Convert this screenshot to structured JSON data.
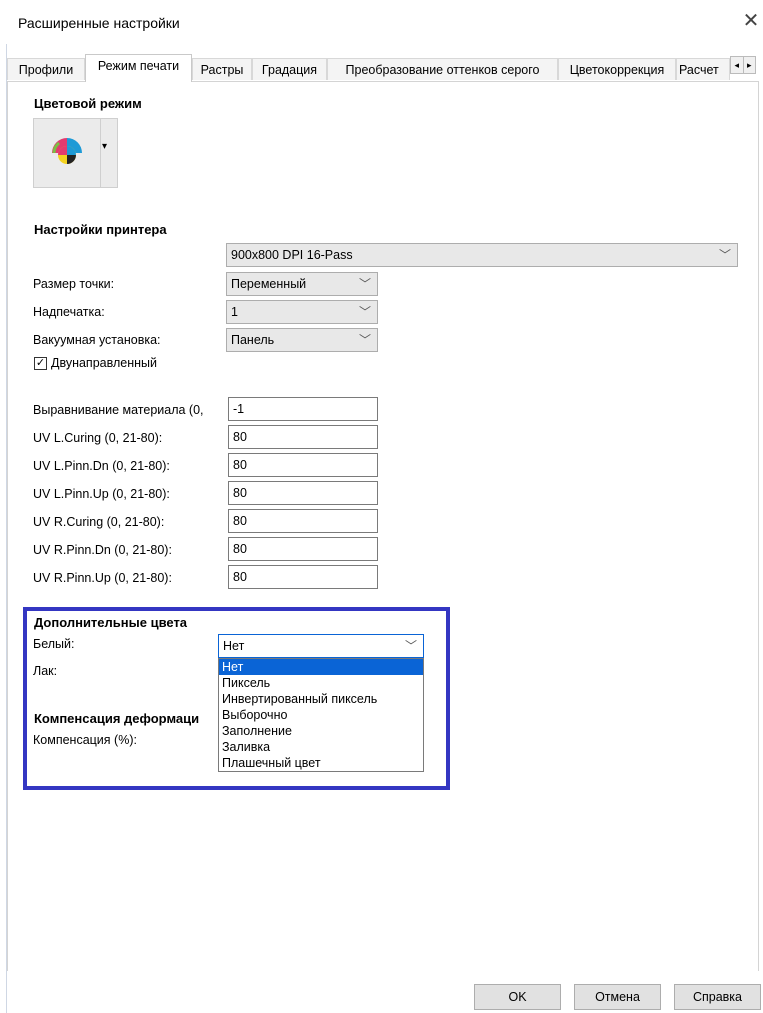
{
  "window": {
    "title": "Расширенные настройки",
    "close": "✕"
  },
  "tabs": [
    {
      "label": "Профили"
    },
    {
      "label": "Режим печати"
    },
    {
      "label": "Растры"
    },
    {
      "label": "Градация"
    },
    {
      "label": "Преобразование оттенков серого"
    },
    {
      "label": "Цветокоррекция"
    },
    {
      "label": "Расчет"
    }
  ],
  "tab_scroll": {
    "left": "◂",
    "right": "▸"
  },
  "color_mode": {
    "heading": "Цветовой режим",
    "icon": "cmyk-color-wheel-icon",
    "arrow": "▾"
  },
  "printer": {
    "heading": "Настройки принтера",
    "resolution": "900x800 DPI 16-Pass",
    "dot_size": {
      "label": "Размер точки:",
      "value": "Переменный"
    },
    "overprint": {
      "label": "Надпечатка:",
      "value": "1"
    },
    "vacuum": {
      "label": "Вакуумная установка:",
      "value": "Панель"
    },
    "bidirectional": {
      "label": "Двунаправленный",
      "checked": true,
      "mark": "✓"
    },
    "fields": [
      {
        "label": "Выравнивание материала (0,",
        "value": "-1"
      },
      {
        "label": "UV L.Curing (0, 21-80):",
        "value": "80"
      },
      {
        "label": "UV L.Pinn.Dn (0, 21-80):",
        "value": "80"
      },
      {
        "label": "UV L.Pinn.Up (0, 21-80):",
        "value": "80"
      },
      {
        "label": "UV R.Curing (0, 21-80):",
        "value": "80"
      },
      {
        "label": "UV R.Pinn.Dn (0, 21-80):",
        "value": "80"
      },
      {
        "label": "UV R.Pinn.Up (0, 21-80):",
        "value": "80"
      }
    ]
  },
  "extra_colors": {
    "heading": "Дополнительные цвета",
    "white": {
      "label": "Белый:",
      "value": "Нет"
    },
    "varnish": {
      "label": "Лак:"
    },
    "options": [
      "Нет",
      "Пиксель",
      "Инвертированный пиксель",
      "Выборочно",
      "Заполнение",
      "Заливка",
      "Плашечный цвет"
    ],
    "selected_index": 0
  },
  "deformation": {
    "heading": "Компенсация деформаци",
    "label": "Компенсация (%):"
  },
  "chevron": "﹀",
  "buttons": {
    "ok": "OK",
    "cancel": "Отмена",
    "help": "Справка"
  },
  "colors": {
    "highlight": "#3436c2",
    "selection": "#0a64d6"
  }
}
